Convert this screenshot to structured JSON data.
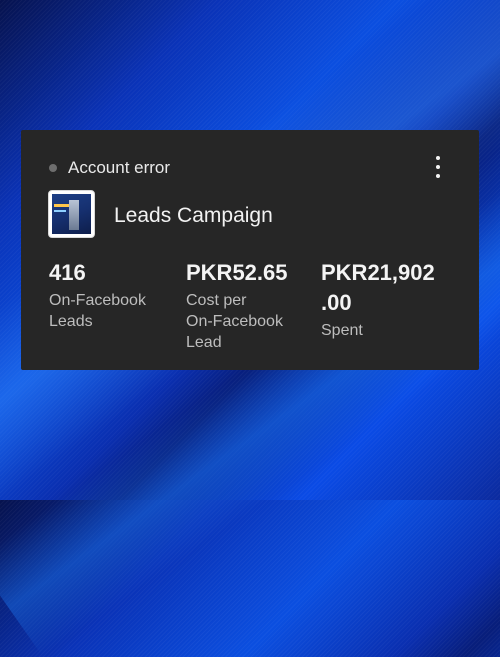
{
  "card": {
    "status": "Account error",
    "campaign_name": "Leads Campaign",
    "metrics": [
      {
        "value_lines": [
          "416"
        ],
        "label_lines": [
          "On-Facebook",
          "Leads"
        ]
      },
      {
        "value_lines": [
          "PKR52.65"
        ],
        "label_lines": [
          "Cost per",
          "On-Facebook",
          "Lead"
        ]
      },
      {
        "value_lines": [
          "PKR21,902",
          ".00"
        ],
        "label_lines": [
          "Spent"
        ]
      }
    ]
  },
  "icons": {
    "status_dot": "status-dot-icon",
    "more": "more-vertical-icon",
    "thumbnail": "campaign-thumbnail"
  },
  "colors": {
    "card_background": "#262626",
    "text_primary": "#f2f2f2",
    "text_secondary": "#bdbdbd",
    "status_dot": "#6e6e6e"
  }
}
